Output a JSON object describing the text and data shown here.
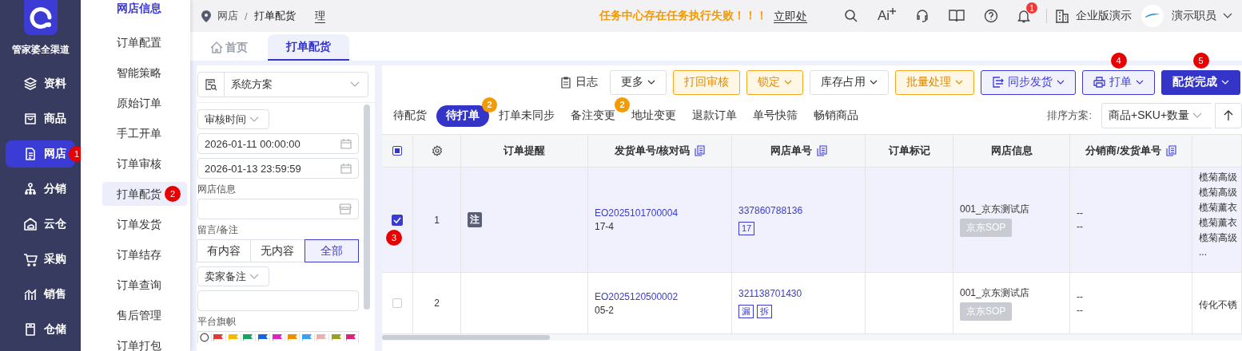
{
  "sidebar": {
    "logo_text": "管家婆全渠道",
    "items": [
      {
        "label": "资料",
        "selected": false
      },
      {
        "label": "商品",
        "selected": false
      },
      {
        "label": "网店",
        "selected": true,
        "marker": "1"
      },
      {
        "label": "分销",
        "selected": false
      },
      {
        "label": "云仓",
        "selected": false
      },
      {
        "label": "采购",
        "selected": false
      },
      {
        "label": "销售",
        "selected": false
      },
      {
        "label": "仓储",
        "selected": false
      }
    ]
  },
  "submenu": {
    "title": "网店信息",
    "items": [
      {
        "label": "订单配置",
        "selected": false
      },
      {
        "label": "智能策略",
        "selected": false
      },
      {
        "label": "原始订单",
        "selected": false
      },
      {
        "label": "手工开单",
        "selected": false
      },
      {
        "label": "订单审核",
        "selected": false
      },
      {
        "label": "打单配货",
        "selected": true,
        "marker": "2"
      },
      {
        "label": "订单发货",
        "selected": false
      },
      {
        "label": "订单结存",
        "selected": false
      },
      {
        "label": "订单查询",
        "selected": false
      },
      {
        "label": "售后管理",
        "selected": false
      },
      {
        "label": "订单打包",
        "selected": false
      }
    ]
  },
  "topbar": {
    "breadcrumb": [
      "网店",
      "打单配货"
    ],
    "breadcrumb_separator": "/",
    "hidden_text": "理",
    "notice": "任务中心存在任务执行失败！！！",
    "notice_link": "立即处",
    "ai_label": "Ai",
    "notification_count": "1",
    "company": "企业版演示",
    "user": "演示职员"
  },
  "page_tabs": [
    {
      "label": "首页",
      "selected": false
    },
    {
      "label": "打单配货",
      "selected": true
    }
  ],
  "filter": {
    "scheme": "系统方案",
    "date_type": "审核时间",
    "start": "2026-01-11 00:00:00",
    "end": "2026-01-13 23:59:59",
    "shop_label": "网店信息",
    "remark_label": "留言/备注",
    "remark_options": [
      {
        "label": "有内容",
        "selected": false
      },
      {
        "label": "无内容",
        "selected": false
      },
      {
        "label": "全部",
        "selected": true
      }
    ],
    "seller_note": "卖家备注",
    "flags_label": "平台旗帜",
    "flags": [
      {
        "color": "#e53935"
      },
      {
        "color": "#f5b800"
      },
      {
        "color": "#1aa260"
      },
      {
        "color": "#1565e0"
      },
      {
        "color": "#e020c0"
      },
      {
        "color": "#f08c00"
      },
      {
        "color": "#3aa0f0"
      },
      {
        "color": "#e8b0b0"
      },
      {
        "color": "#9aa020"
      },
      {
        "color": "#e0207a"
      }
    ]
  },
  "toolbar": [
    {
      "label": "日志",
      "kind": "text",
      "dropdown": false
    },
    {
      "label": "更多",
      "kind": "default",
      "dropdown": true
    },
    {
      "label": "打回审核",
      "kind": "warning",
      "dropdown": false
    },
    {
      "label": "锁定",
      "kind": "warning",
      "dropdown": true
    },
    {
      "label": "库存占用",
      "kind": "default",
      "dropdown": true
    },
    {
      "label": "批量处理",
      "kind": "warning",
      "dropdown": true
    },
    {
      "label": "同步发货",
      "kind": "outline",
      "dropdown": true
    },
    {
      "label": "打单",
      "kind": "outline",
      "dropdown": true,
      "marker": "4"
    },
    {
      "label": "配货完成",
      "kind": "primary",
      "dropdown": true,
      "marker": "5"
    }
  ],
  "status_tabs": [
    {
      "label": "待配货",
      "selected": false
    },
    {
      "label": "待打单",
      "selected": true,
      "badge": "2"
    },
    {
      "label": "打单未同步",
      "selected": false
    },
    {
      "label": "备注变更",
      "selected": false,
      "badge": "2"
    },
    {
      "label": "地址变更",
      "selected": false
    },
    {
      "label": "退款订单",
      "selected": false
    },
    {
      "label": "单号快筛",
      "selected": false
    },
    {
      "label": "畅销商品",
      "selected": false
    }
  ],
  "sort": {
    "label": "排序方案:",
    "value": "商品+SKU+数量"
  },
  "table": {
    "select_all_indeterminate": true,
    "columns": [
      {
        "label": "订单提醒",
        "copy": false
      },
      {
        "label": "发货单号/核对码",
        "copy": true
      },
      {
        "label": "网店单号",
        "copy": true
      },
      {
        "label": "订单标记",
        "copy": false
      },
      {
        "label": "网店信息",
        "copy": false
      },
      {
        "label": "分销商/发货单号",
        "copy": true
      }
    ],
    "rows": [
      {
        "selected": true,
        "marker": "3",
        "index": "1",
        "reminders": [
          "注"
        ],
        "delivery_no": "EO2025101700004",
        "check_code": "17-4",
        "shop_order": "337860788136",
        "shop_order_tags": [
          "17"
        ],
        "shop_name": "001_京东测试店",
        "platform": "京东SOP",
        "distributor": [
          "--",
          "--"
        ],
        "column_9": [
          "榄菊高级",
          "榄菊高级",
          "榄菊薰衣",
          "榄菊薰衣",
          "榄菊高级",
          "..."
        ]
      },
      {
        "selected": false,
        "index": "2",
        "reminders": [],
        "delivery_no": "EO2025120500002",
        "check_code": "05-2",
        "shop_order": "321138701430",
        "shop_order_tags": [
          "漏",
          "拆"
        ],
        "shop_name": "001_京东测试店",
        "platform": "京东SOP",
        "distributor": [
          "--",
          "--"
        ],
        "column_9": [
          "传化不锈"
        ]
      }
    ]
  }
}
